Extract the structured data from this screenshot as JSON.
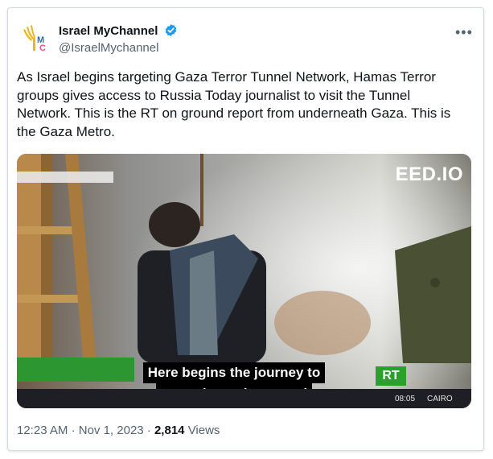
{
  "author": {
    "name": "Israel MyChannel",
    "handle": "@IsraelMychannel",
    "verified": true
  },
  "tweet": {
    "text": "As Israel begins targeting Gaza Terror Tunnel Network, Hamas Terror groups gives access to Russia Today journalist to visit the Tunnel Network. This is the RT on ground report from underneath Gaza. This is the Gaza Metro."
  },
  "media": {
    "watermark": "EED.IO",
    "caption_line1": "Here begins the journey to",
    "caption_line2": "enter the underground",
    "channel_badge": "RT",
    "ticker_time": "08:05",
    "ticker_city": "CAIRO"
  },
  "meta": {
    "time": "12:23 AM",
    "date": "Nov 1, 2023",
    "views_count": "2,814",
    "views_label": "Views",
    "separator": "·"
  },
  "colors": {
    "verified": "#1d9bf0",
    "secondary_text": "#536471",
    "rt_green": "#2aa12a"
  },
  "icons": {
    "more": "more-horizontal-icon",
    "verified": "verified-badge-icon"
  }
}
